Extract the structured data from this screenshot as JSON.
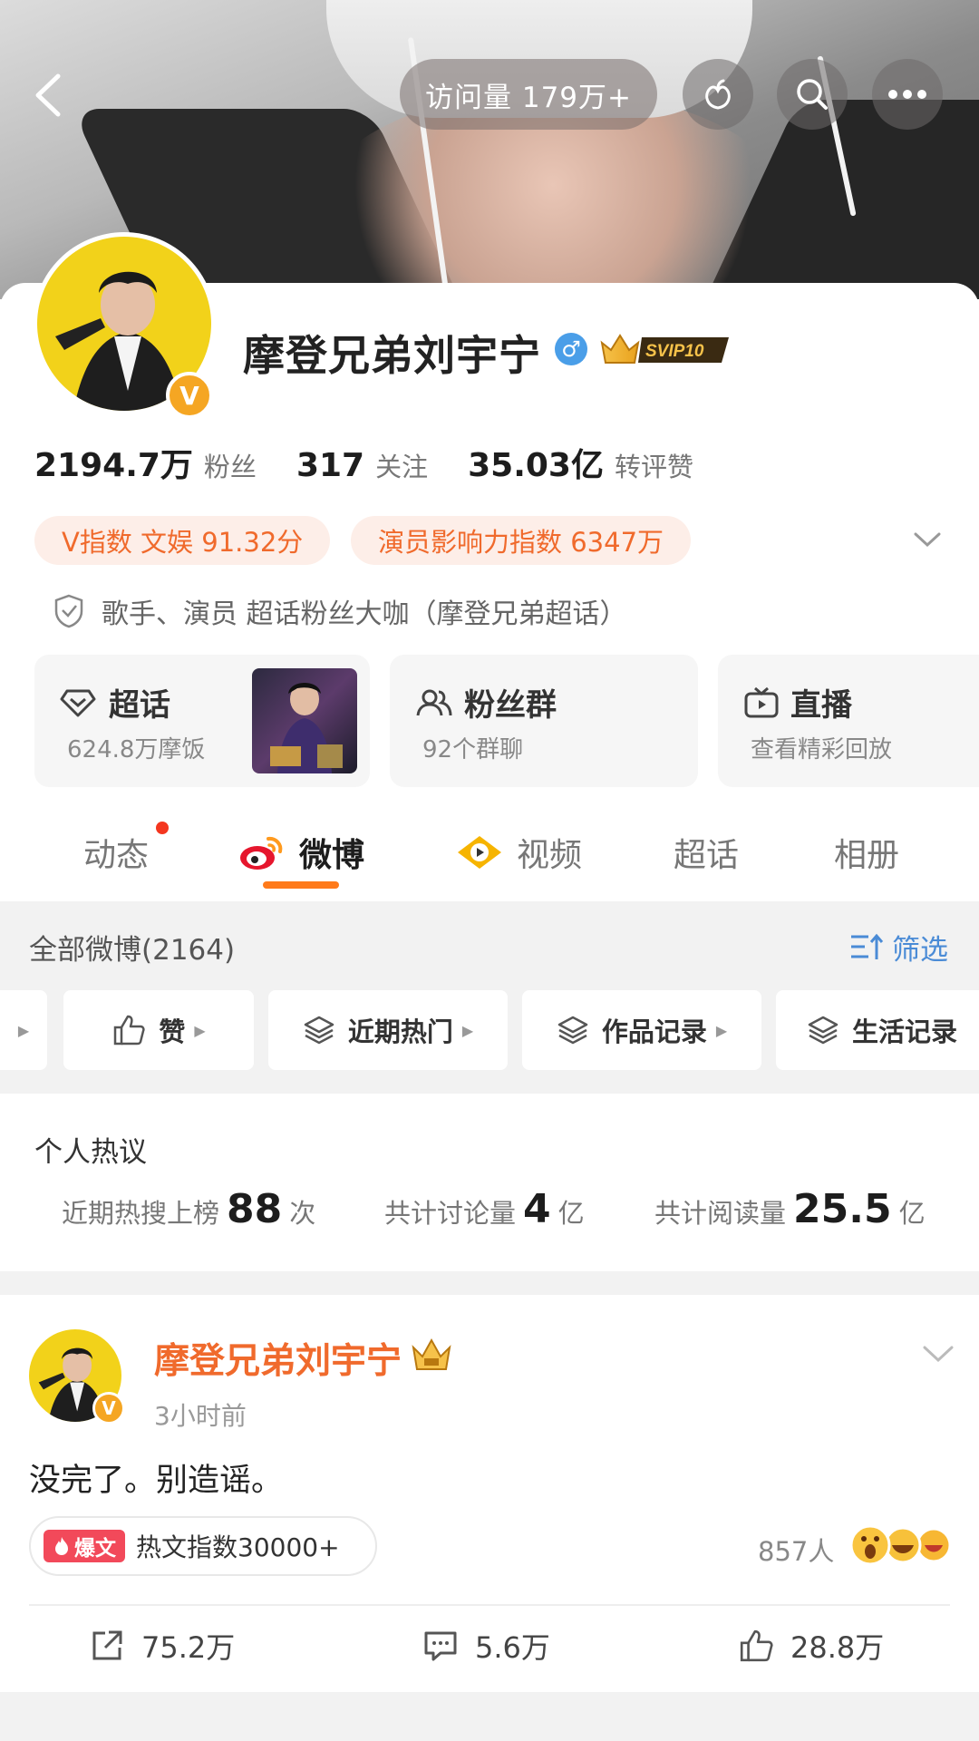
{
  "header": {
    "visit_label": "访问量 179万+",
    "back_icon": "back-arrow-icon",
    "icons": [
      "peach-icon",
      "search-icon",
      "more-icon"
    ]
  },
  "profile": {
    "name": "摩登兄弟刘宇宁",
    "gender": "♂",
    "svip": "SVIP10",
    "verified_badge": "V",
    "stats": [
      {
        "num": "2194.7万",
        "label": "粉丝"
      },
      {
        "num": "317",
        "label": "关注"
      },
      {
        "num": "35.03亿",
        "label": "转评赞"
      }
    ],
    "tags": [
      "V指数 文娱 91.32分",
      "演员影响力指数 6347万"
    ],
    "bio": "歌手、演员 超话粉丝大咖（摩登兄弟超话）"
  },
  "quick_cards": [
    {
      "title": "超话",
      "sub": "624.8万摩饭",
      "icon": "diamond-icon"
    },
    {
      "title": "粉丝群",
      "sub": "92个群聊",
      "icon": "group-icon"
    },
    {
      "title": "直播",
      "sub": "查看精彩回放",
      "icon": "tv-icon"
    }
  ],
  "tabs": [
    "动态",
    "微博",
    "视频",
    "超话",
    "相册"
  ],
  "feed": {
    "all_label": "全部微博(2164)",
    "filter_label": "筛选",
    "chips": [
      "赞",
      "近期热门",
      "作品记录",
      "生活记录"
    ]
  },
  "hot": {
    "title": "个人热议",
    "items": [
      {
        "pre": "近期热搜上榜",
        "num": "88",
        "unit": "次"
      },
      {
        "pre": "共计讨论量",
        "num": "4",
        "unit": "亿"
      },
      {
        "pre": "共计阅读量",
        "num": "25.5",
        "unit": "亿"
      }
    ]
  },
  "post": {
    "author": "摩登兄弟刘宇宁",
    "time": "3小时前",
    "text": "没完了。别造谣。",
    "hot_badge": "爆文",
    "hot_text": "热文指数30000+",
    "people": "857人",
    "repost": "75.2万",
    "comment": "5.6万",
    "like": "28.8万"
  },
  "colors": {
    "accent": "#ff7a1a",
    "orange_text": "#f06a2c",
    "link_blue": "#4a8bd6"
  }
}
